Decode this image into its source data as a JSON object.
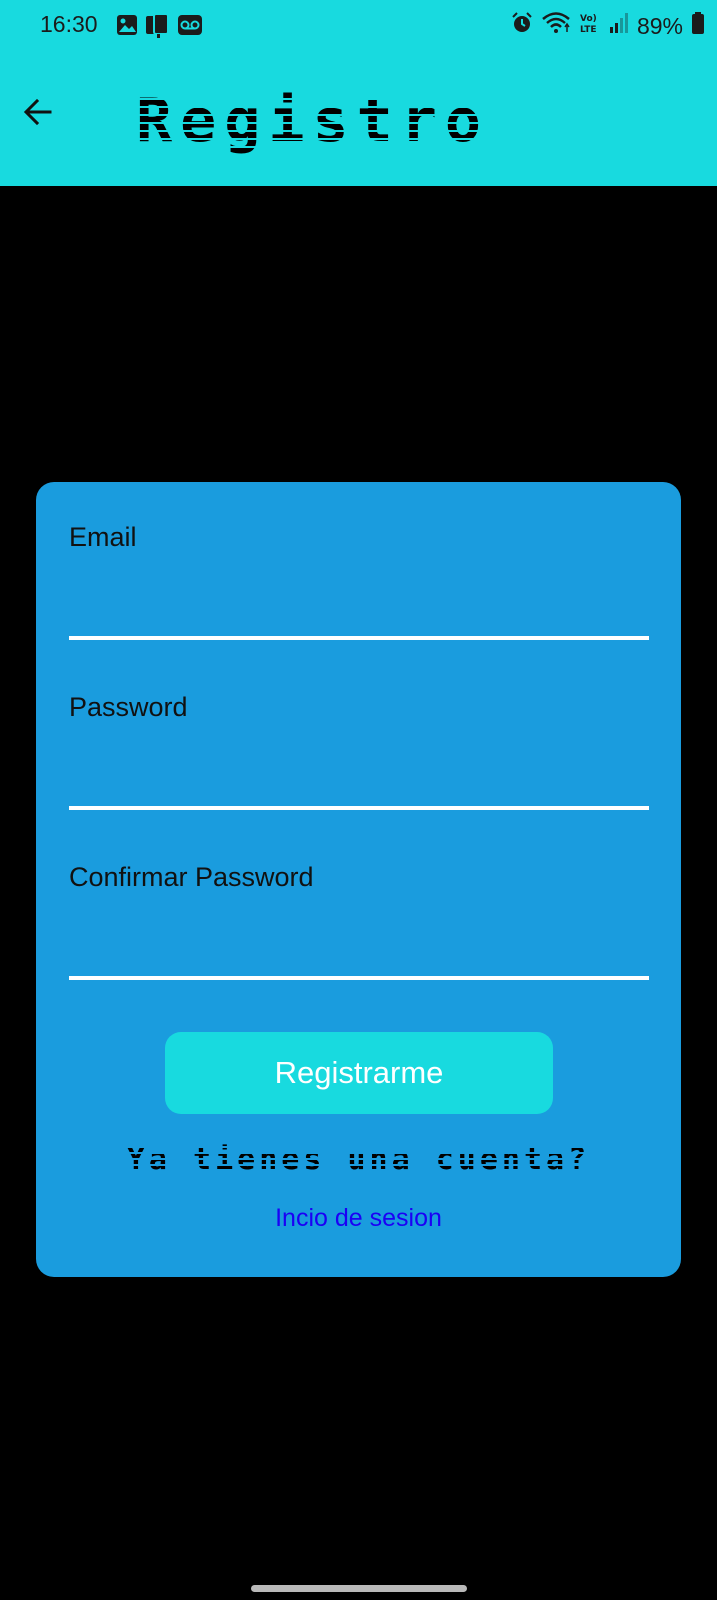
{
  "status_bar": {
    "time": "16:30",
    "battery": "89%",
    "left_icons": [
      "gallery-icon",
      "screen-mirror-icon",
      "voicemail-icon"
    ],
    "right_icons": [
      "alarm-icon",
      "wifi-icon",
      "volte-icon",
      "signal-icon",
      "battery-icon"
    ],
    "volte_label": "Vo) LTE"
  },
  "app_bar": {
    "title": "Registro",
    "back_icon": "arrow-left-icon",
    "background": "#18DADF"
  },
  "form": {
    "background": "#1A9CDE",
    "fields": [
      {
        "label": "Email",
        "value": "",
        "placeholder": ""
      },
      {
        "label": "Password",
        "value": "",
        "placeholder": ""
      },
      {
        "label": "Confirmar Password",
        "value": "",
        "placeholder": ""
      }
    ],
    "submit_label": "Registrarme",
    "question": "Ya tienes una cuenta?",
    "login_link": "Incio de sesion",
    "link_color": "#1B00F5"
  }
}
